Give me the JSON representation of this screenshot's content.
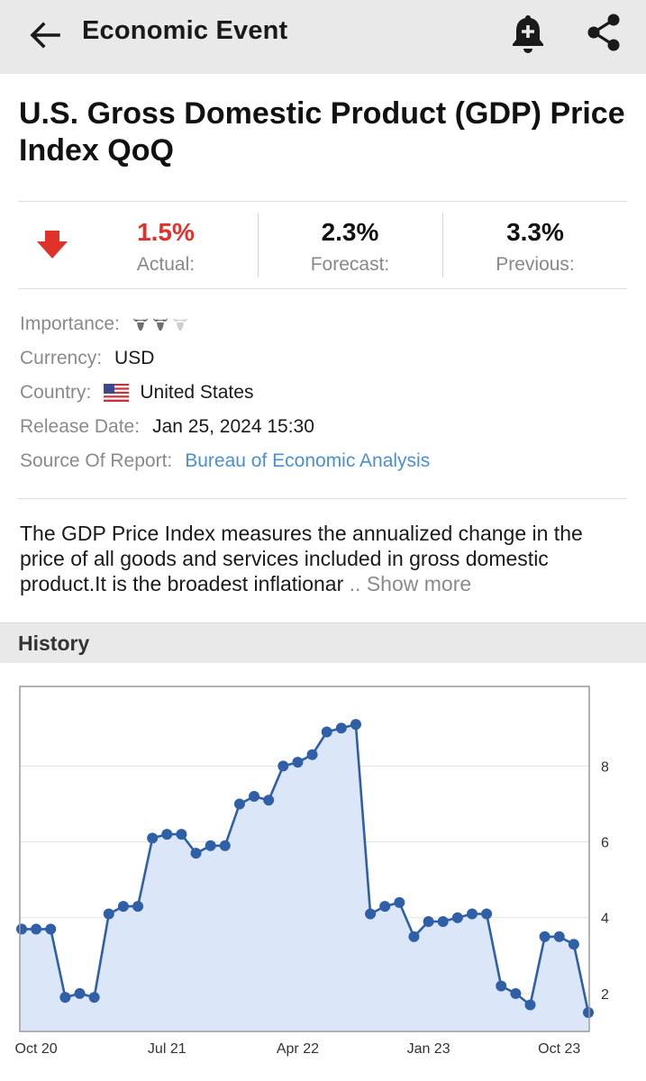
{
  "appbar": {
    "title": "Economic Event",
    "back_icon": "arrow-left-icon",
    "alert_icon": "bell-plus-icon",
    "share_icon": "share-icon"
  },
  "event": {
    "title": "U.S. Gross Domestic Product (GDP) Price Index QoQ"
  },
  "stats": {
    "trend_icon": "arrow-down-icon",
    "actual": {
      "value": "1.5%",
      "label": "Actual:",
      "color": "#e0312b"
    },
    "forecast": {
      "value": "2.3%",
      "label": "Forecast:"
    },
    "previous": {
      "value": "3.3%",
      "label": "Previous:"
    }
  },
  "info": {
    "importance_label": "Importance:",
    "importance_level": 2,
    "importance_max": 3,
    "currency_label": "Currency:",
    "currency_value": "USD",
    "country_label": "Country:",
    "country_value": "United States",
    "release_label": "Release Date:",
    "release_value": "Jan 25, 2024 15:30",
    "source_label": "Source Of Report:",
    "source_value": "Bureau of Economic Analysis"
  },
  "description": {
    "text": "The GDP Price Index measures the annualized change in the price of all goods and services included in gross domestic product.It is the broadest inflationar",
    "more_label": ".. Show more"
  },
  "history": {
    "label": "History"
  },
  "chart_data": {
    "type": "area",
    "title": "",
    "xlabel": "",
    "ylabel": "",
    "x_tick_labels": [
      "Oct 20",
      "Jul 21",
      "Apr 22",
      "Jan 23",
      "Oct 23"
    ],
    "x_tick_index": [
      1,
      10,
      19,
      28,
      37
    ],
    "y_ticks": [
      2,
      4,
      6,
      8
    ],
    "ylim": [
      1.0,
      10.1
    ],
    "grid": true,
    "y_axis_position": "right",
    "line_color": "#2f5fa6",
    "fill_color": "#dbe6f9",
    "values": [
      3.7,
      3.7,
      3.7,
      1.9,
      2.0,
      1.9,
      4.1,
      4.3,
      4.3,
      6.1,
      6.2,
      6.2,
      5.7,
      5.9,
      5.9,
      7.0,
      7.2,
      7.1,
      8.0,
      8.1,
      8.3,
      8.9,
      9.0,
      9.1,
      4.1,
      4.3,
      4.4,
      3.5,
      3.9,
      3.9,
      4.0,
      4.1,
      4.1,
      2.2,
      2.0,
      1.7,
      3.5,
      3.5,
      3.3,
      1.5
    ]
  }
}
